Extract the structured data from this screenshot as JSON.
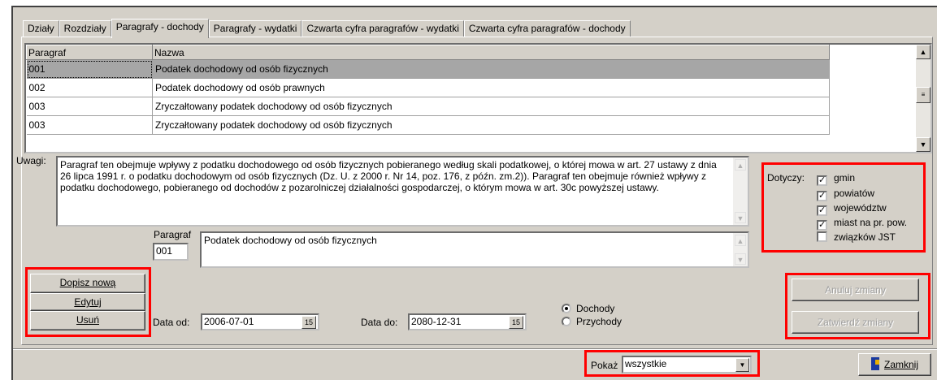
{
  "tabs": [
    "Działy",
    "Rozdziały",
    "Paragrafy - dochody",
    "Paragrafy - wydatki",
    "Czwarta cyfra paragrafów - wydatki",
    "Czwarta cyfra paragrafów - dochody"
  ],
  "grid": {
    "headers": [
      "Paragraf",
      "Nazwa"
    ],
    "rows": [
      [
        "001",
        "Podatek dochodowy od osób fizycznych"
      ],
      [
        "002",
        "Podatek dochodowy od osób prawnych"
      ],
      [
        "003",
        "Zryczałtowany podatek dochodowy od osób fizycznych"
      ],
      [
        "003",
        "Zryczałtowany podatek dochodowy od osób fizycznych"
      ]
    ]
  },
  "uwagi": {
    "label": "Uwagi:",
    "text": "Paragraf ten obejmuje wpływy z podatku dochodowego od osób fizycznych pobieranego według skali podatkowej, o której mowa w art. 27 ustawy z dnia 26 lipca 1991 r. o podatku dochodowym od osób fizycznych (Dz. U. z 2000 r. Nr 14, poz. 176, z późn. zm.2)). Paragraf ten obejmuje również wpływy z podatku dochodowego, pobieranego od dochodów z pozarolniczej działalności gospodarczej, o którym mowa w art. 30c powyższej ustawy."
  },
  "dotyczy": {
    "label": "Dotyczy:",
    "items": [
      {
        "label": "gmin",
        "checked": true
      },
      {
        "label": "powiatów",
        "checked": true
      },
      {
        "label": "województw",
        "checked": true
      },
      {
        "label": "miast na pr. pow.",
        "checked": true
      },
      {
        "label": "związków JST",
        "checked": false
      }
    ]
  },
  "paragraf": {
    "label": "Paragraf",
    "code": "001",
    "name": "Podatek dochodowy od osób fizycznych"
  },
  "buttons": {
    "add": "Dopisz nową",
    "edit": "Edytuj",
    "delete": "Usuń",
    "cancel": "Anuluj zmiany",
    "confirm": "Zatwierdź zmiany",
    "close": "Zamknij"
  },
  "dates": {
    "from_label": "Data od:",
    "from": "2006-07-01",
    "to_label": "Data do:",
    "to": "2080-12-31",
    "cal_icon": "15"
  },
  "type_radio": {
    "options": [
      "Dochody",
      "Przychody"
    ],
    "selected": "Dochody"
  },
  "show": {
    "label": "Pokaż",
    "value": "wszystkie"
  },
  "colors": {
    "highlight": "#ff0000",
    "selected_row": "#a6a6a6",
    "window_bg": "#d4d0c8"
  }
}
